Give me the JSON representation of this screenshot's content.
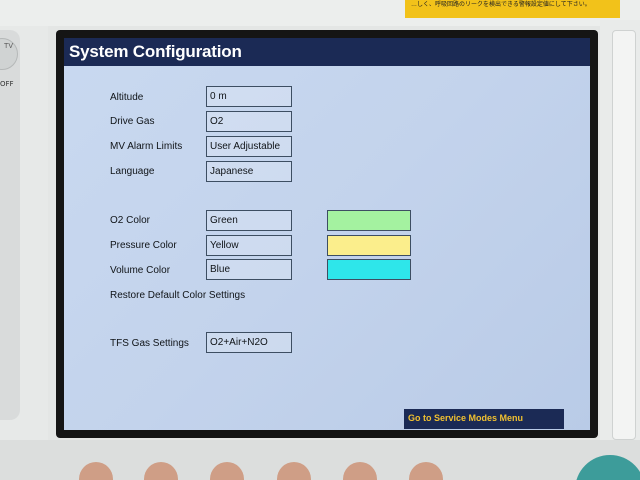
{
  "device": {
    "warning_label": "…しく、呼吸回路のリークを検出できる警報設定値にして下さい。",
    "alarm_knob_label": "TV",
    "off_label": "OFF"
  },
  "screen": {
    "title": "System Configuration",
    "settings": [
      {
        "label": "Altitude",
        "value": "0 m"
      },
      {
        "label": "Drive Gas",
        "value": "O2"
      },
      {
        "label": "MV Alarm Limits",
        "value": "User Adjustable"
      },
      {
        "label": "Language",
        "value": "Japanese"
      }
    ],
    "colors": [
      {
        "label": "O2 Color",
        "value": "Green",
        "swatch": "#a4f2a0"
      },
      {
        "label": "Pressure Color",
        "value": "Yellow",
        "swatch": "#fbee8c"
      },
      {
        "label": "Volume Color",
        "value": "Blue",
        "swatch": "#2ee6ea"
      }
    ],
    "restore_label": "Restore Default Color Settings",
    "tfs": {
      "label": "TFS Gas Settings",
      "value": "O2+Air+N2O"
    },
    "service_button": "Go to Service Modes Menu"
  }
}
